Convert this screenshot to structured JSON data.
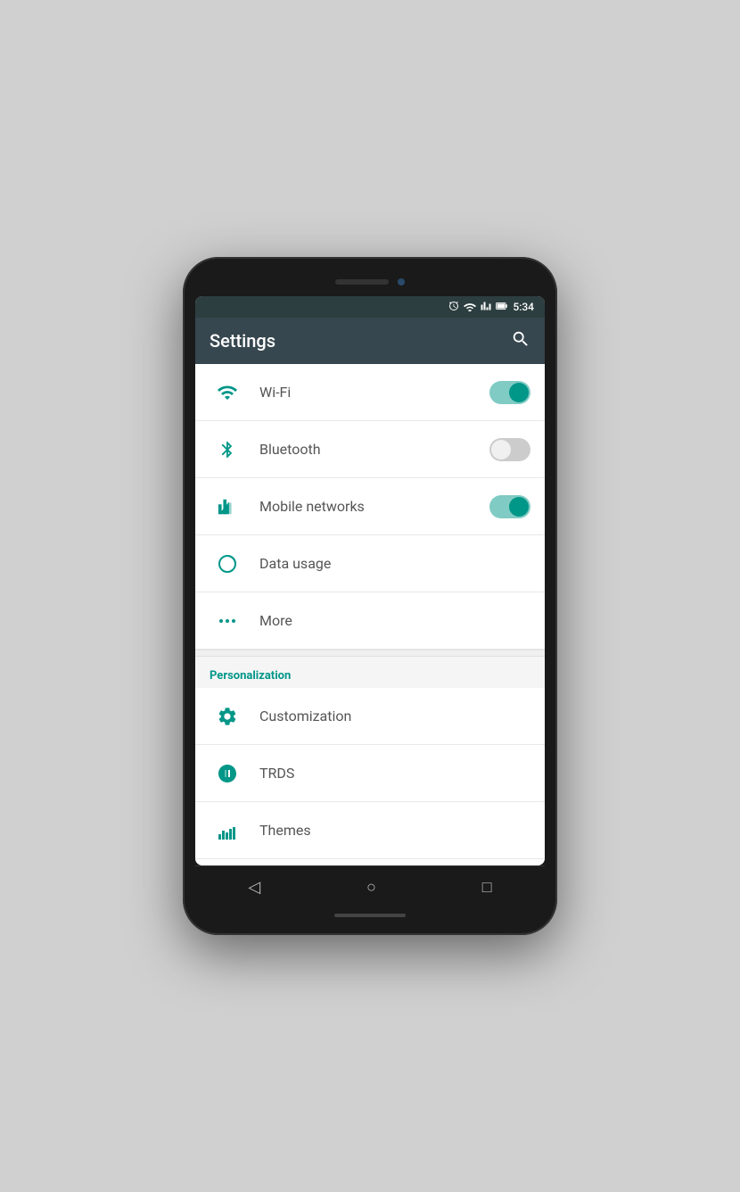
{
  "status_bar": {
    "time": "5:34",
    "icons": [
      "alarm",
      "wifi",
      "signal",
      "battery"
    ]
  },
  "app_bar": {
    "title": "Settings",
    "search_label": "🔍"
  },
  "sections": [
    {
      "id": "wireless",
      "header": null,
      "items": [
        {
          "id": "wifi",
          "label": "Wi-Fi",
          "icon": "wifi",
          "toggle": true,
          "toggle_state": "on"
        },
        {
          "id": "bluetooth",
          "label": "Bluetooth",
          "icon": "bluetooth",
          "toggle": true,
          "toggle_state": "off"
        },
        {
          "id": "mobile_networks",
          "label": "Mobile networks",
          "icon": "signal",
          "toggle": true,
          "toggle_state": "on"
        },
        {
          "id": "data_usage",
          "label": "Data usage",
          "icon": "data",
          "toggle": false
        },
        {
          "id": "more",
          "label": "More",
          "icon": "more_dots",
          "toggle": false
        }
      ]
    },
    {
      "id": "personalization",
      "header": "Personalization",
      "items": [
        {
          "id": "customization",
          "label": "Customization",
          "icon": "gear",
          "toggle": false
        },
        {
          "id": "trds",
          "label": "TRDS",
          "icon": "trds_leaf",
          "toggle": false
        },
        {
          "id": "themes",
          "label": "Themes",
          "icon": "themes_bars",
          "toggle": false
        }
      ]
    }
  ],
  "nav_bar": {
    "back_label": "◁",
    "home_label": "○",
    "recent_label": "□"
  }
}
